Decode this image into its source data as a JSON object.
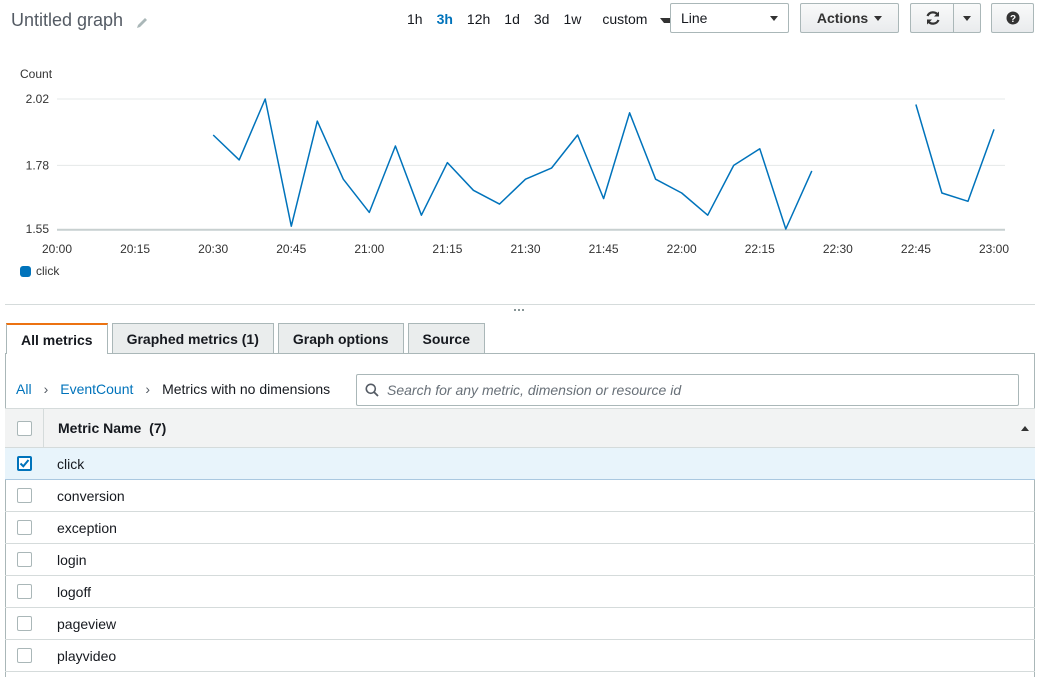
{
  "header": {
    "title": "Untitled graph",
    "time_ranges": [
      "1h",
      "3h",
      "12h",
      "1d",
      "3d",
      "1w"
    ],
    "active_range": "3h",
    "custom_label": "custom",
    "view_select": "Line",
    "actions_label": "Actions"
  },
  "chart_data": {
    "type": "line",
    "ylabel": "Count",
    "yticks": [
      "2.02",
      "1.78",
      "1.55"
    ],
    "ylim": [
      1.55,
      2.02
    ],
    "xticks": [
      "20:00",
      "20:15",
      "20:30",
      "20:45",
      "21:00",
      "21:15",
      "21:30",
      "21:45",
      "22:00",
      "22:15",
      "22:30",
      "22:45",
      "23:00"
    ],
    "grid": true,
    "legend_position": "bottom-left",
    "series": [
      {
        "name": "click",
        "color": "#0073bb",
        "segments": [
          [
            [
              "20:30",
              1.89
            ],
            [
              "20:35",
              1.8
            ],
            [
              "20:40",
              2.02
            ],
            [
              "20:45",
              1.56
            ],
            [
              "20:50",
              1.94
            ],
            [
              "20:55",
              1.73
            ],
            [
              "21:00",
              1.61
            ],
            [
              "21:05",
              1.85
            ],
            [
              "21:10",
              1.6
            ],
            [
              "21:15",
              1.79
            ],
            [
              "21:20",
              1.69
            ],
            [
              "21:25",
              1.64
            ],
            [
              "21:30",
              1.73
            ],
            [
              "21:35",
              1.77
            ],
            [
              "21:40",
              1.89
            ],
            [
              "21:45",
              1.66
            ],
            [
              "21:50",
              1.97
            ],
            [
              "21:55",
              1.73
            ],
            [
              "22:00",
              1.68
            ],
            [
              "22:05",
              1.6
            ],
            [
              "22:10",
              1.78
            ],
            [
              "22:15",
              1.84
            ],
            [
              "22:20",
              1.55
            ],
            [
              "22:25",
              1.76
            ]
          ],
          [
            [
              "22:45",
              2.0
            ],
            [
              "22:50",
              1.68
            ],
            [
              "22:55",
              1.65
            ],
            [
              "23:00",
              1.91
            ]
          ]
        ]
      }
    ]
  },
  "legend": {
    "label": "click"
  },
  "tabs": [
    {
      "label": "All metrics",
      "active": true
    },
    {
      "label": "Graphed metrics (1)",
      "active": false
    },
    {
      "label": "Graph options",
      "active": false
    },
    {
      "label": "Source",
      "active": false
    }
  ],
  "breadcrumb": {
    "root": "All",
    "namespace": "EventCount",
    "current": "Metrics with no dimensions"
  },
  "search": {
    "placeholder": "Search for any metric, dimension or resource id",
    "value": ""
  },
  "table": {
    "header": "Metric Name",
    "count": "(7)",
    "rows": [
      {
        "name": "click",
        "checked": true
      },
      {
        "name": "conversion",
        "checked": false
      },
      {
        "name": "exception",
        "checked": false
      },
      {
        "name": "login",
        "checked": false
      },
      {
        "name": "logoff",
        "checked": false
      },
      {
        "name": "pageview",
        "checked": false
      },
      {
        "name": "playvideo",
        "checked": false
      }
    ]
  }
}
